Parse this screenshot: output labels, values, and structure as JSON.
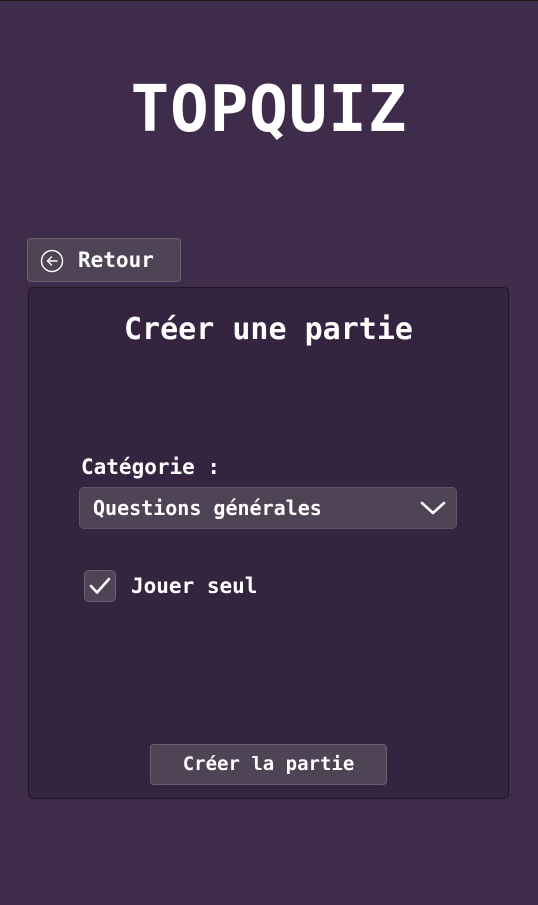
{
  "app": {
    "title": "TOPQUIZ"
  },
  "nav": {
    "back_label": "Retour",
    "back_icon": "arrow-left-circle-icon"
  },
  "form": {
    "title": "Créer une partie",
    "category_label": "Catégorie :",
    "category_value": "Questions générales",
    "dropdown_icon": "chevron-down-icon",
    "solo_label": "Jouer seul",
    "solo_checked": true,
    "submit_label": "Créer la partie"
  },
  "colors": {
    "background": "#3f2b4a",
    "panel": "#352440",
    "control": "#4e4455",
    "text": "#ffffff"
  }
}
